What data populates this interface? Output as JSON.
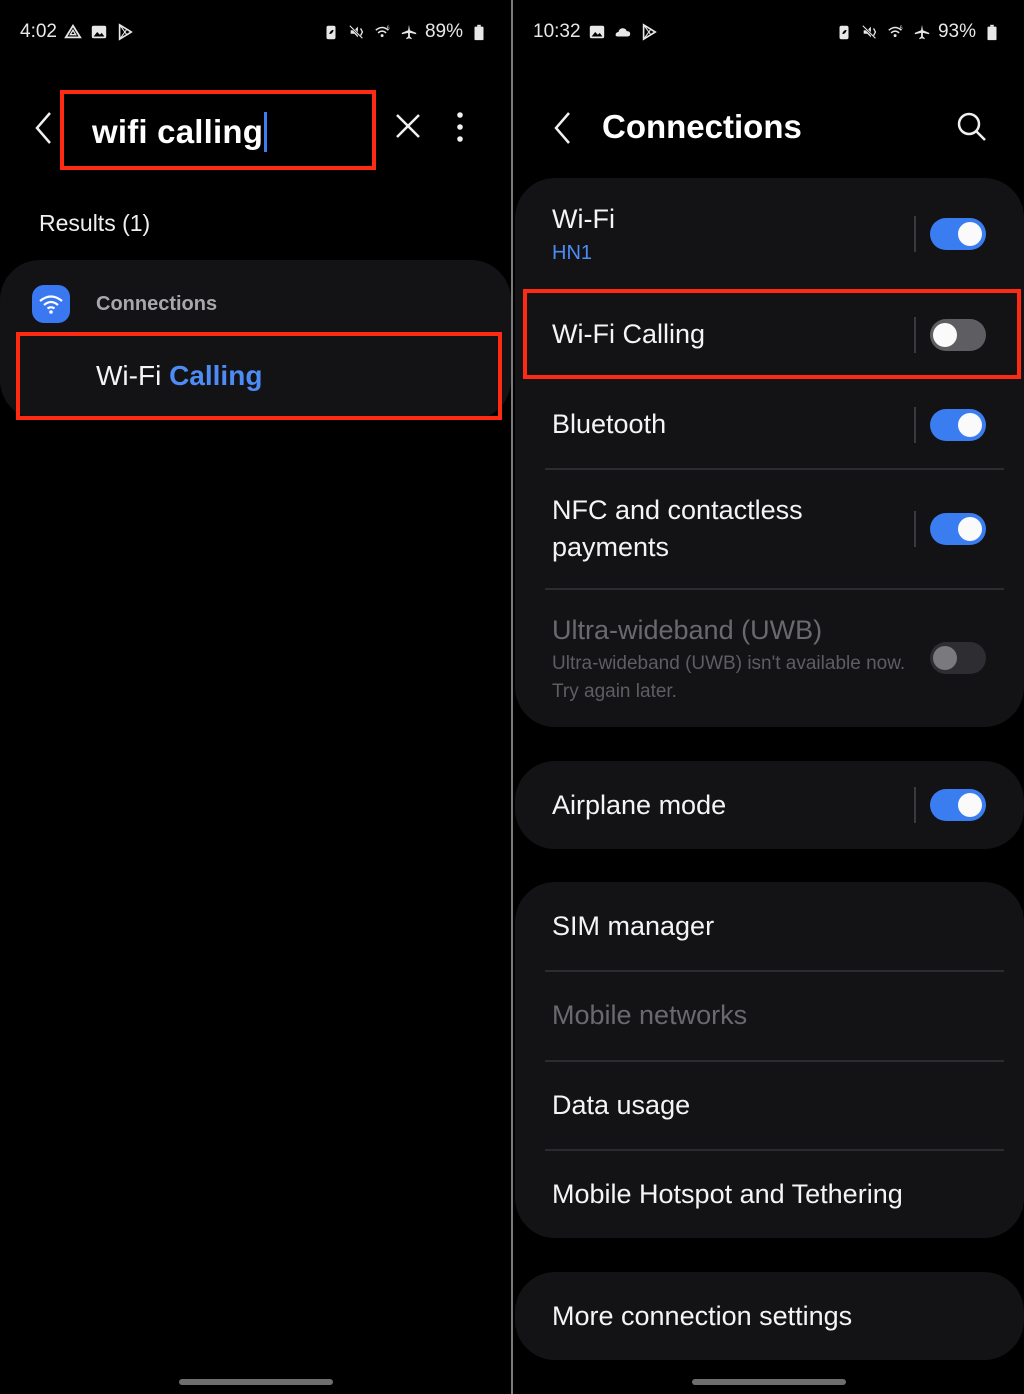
{
  "left": {
    "status": {
      "time": "4:02",
      "battery": "89%",
      "left_icons": [
        "drive-icon",
        "gallery-icon",
        "play-store-icon"
      ],
      "right_icons": [
        "battery-saver-icon",
        "mute-icon",
        "wifi-6-icon",
        "airplane-icon"
      ]
    },
    "search": {
      "query": "wifi calling",
      "back_icon": "back-arrow-icon",
      "clear_icon": "close-icon",
      "more_icon": "more-vert-icon"
    },
    "results_label": "Results (1)",
    "result": {
      "category": "Connections",
      "category_icon": "wifi-icon",
      "title_plain": "Wi-Fi ",
      "title_match": "Calling"
    }
  },
  "right": {
    "status": {
      "time": "10:32",
      "battery": "93%",
      "left_icons": [
        "gallery-icon",
        "cloud-icon",
        "play-store-icon"
      ],
      "right_icons": [
        "battery-saver-icon",
        "mute-icon",
        "wifi-6-icon",
        "airplane-icon"
      ]
    },
    "header": {
      "title": "Connections",
      "back_icon": "back-arrow-icon",
      "search_icon": "search-icon"
    },
    "groups": [
      {
        "items": [
          {
            "title": "Wi-Fi",
            "subtitle": "HN1",
            "toggle": "on"
          },
          {
            "title": "Wi-Fi Calling",
            "toggle": "off",
            "highlighted": true
          },
          {
            "title": "Bluetooth",
            "toggle": "on"
          },
          {
            "title": "NFC and contactless payments",
            "toggle": "on"
          },
          {
            "title": "Ultra-wideband (UWB)",
            "description": "Ultra-wideband (UWB) isn't available now. Try again later.",
            "toggle": "disabled"
          }
        ]
      },
      {
        "items": [
          {
            "title": "Airplane mode",
            "toggle": "on"
          }
        ]
      },
      {
        "items": [
          {
            "title": "SIM manager"
          },
          {
            "title": "Mobile networks",
            "disabled": true
          },
          {
            "title": "Data usage"
          },
          {
            "title": "Mobile Hotspot and Tethering"
          }
        ]
      },
      {
        "items": [
          {
            "title": "More connection settings"
          }
        ]
      }
    ]
  },
  "colors": {
    "accent": "#3a7df0",
    "highlight_box": "#ff2a14",
    "card_bg": "#131316",
    "background": "#000000"
  }
}
